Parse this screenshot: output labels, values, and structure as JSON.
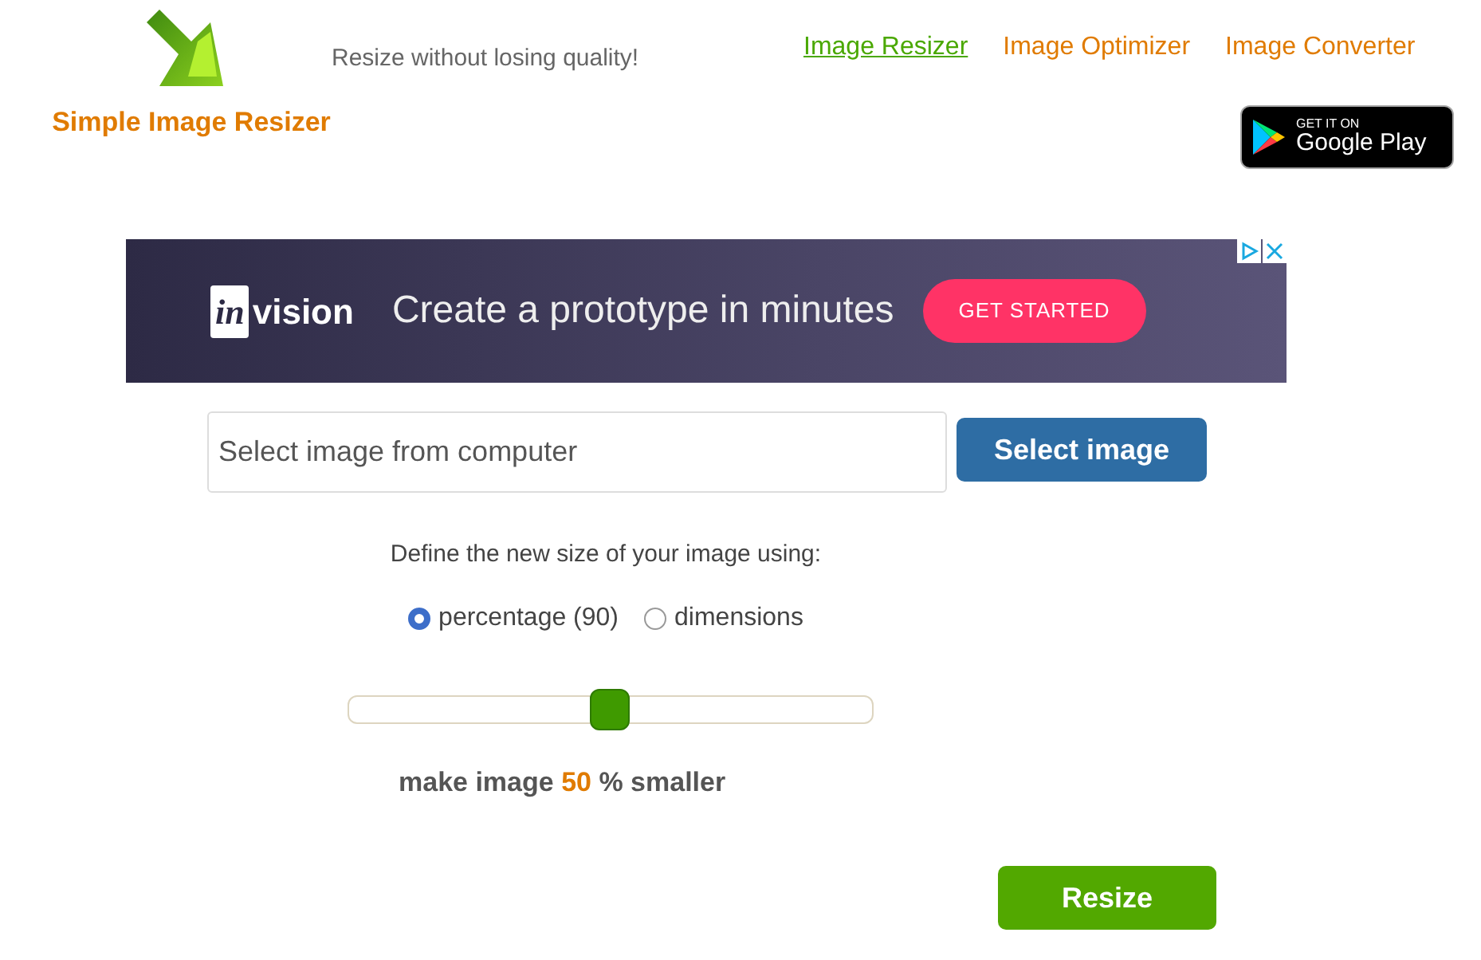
{
  "header": {
    "site_name": "Simple Image Resizer",
    "tagline": "Resize without losing quality!",
    "nav": [
      {
        "label": "Image Resizer",
        "selected": true
      },
      {
        "label": "Image Optimizer",
        "selected": false
      },
      {
        "label": "Image Converter",
        "selected": false
      }
    ],
    "store_badge": {
      "line_1": "GET IT ON",
      "line_2": "Google Play"
    }
  },
  "ad": {
    "brand": "invision",
    "headline": "Create a prototype in minutes",
    "cta": "GET STARTED"
  },
  "upload": {
    "placeholder": "Select image from computer",
    "button": "Select image"
  },
  "resize_mode": {
    "prompt": "Define the new size of your image using:",
    "options": [
      {
        "label": "percentage (90)",
        "selected": true
      },
      {
        "label": "dimensions",
        "selected": false
      }
    ]
  },
  "slider": {
    "level": 0.5
  },
  "summary": {
    "before": "make image",
    "amount": "50",
    "after": "% smaller"
  },
  "resize_button": "Resize"
}
